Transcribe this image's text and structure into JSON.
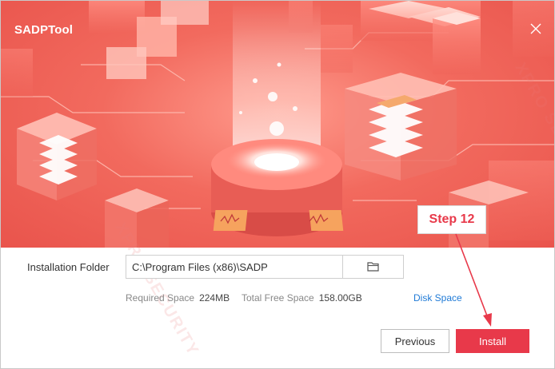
{
  "app": {
    "title": "SADPTool"
  },
  "install": {
    "folder_label": "Installation Folder",
    "folder_path": "C:\\Program Files (x86)\\SADP",
    "required_label": "Required Space",
    "required_value": "224MB",
    "free_label": "Total Free Space",
    "free_value": "158.00GB",
    "disk_space_link": "Disk Space",
    "previous_button": "Previous",
    "install_button": "Install"
  },
  "annotation": {
    "step_label": "Step 12",
    "color": "#e8394a"
  },
  "icons": {
    "close": "close-icon",
    "browse": "folder-icon"
  },
  "colors": {
    "accent": "#e8394a",
    "banner": "#f26a5e",
    "link": "#1f7ad6"
  },
  "watermark": {
    "text": "XPRO SECURITY"
  }
}
